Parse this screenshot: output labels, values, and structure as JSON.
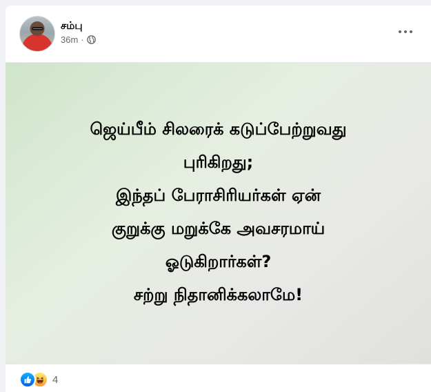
{
  "post": {
    "author": "சம்பு",
    "time": "36m",
    "separator": "·",
    "privacy_icon": "globe-icon",
    "image_text_lines": [
      "ஜெய்பீம் சிலரைக் கடுப்பேற்றுவது",
      "புரிகிறது;",
      "இந்தப் பேராசிரியர்கள் ஏன்",
      "குறுக்கு மறுக்கே அவசரமாய்",
      "ஓடுகிறார்கள்?",
      "சற்று நிதானிக்கலாமே!"
    ],
    "reaction_icons": [
      "like-icon",
      "haha-icon"
    ],
    "reaction_count": "4"
  },
  "colors": {
    "like_blue": "#1877f2",
    "haha_yellow": "#f7b125",
    "secondary_text": "#65676b"
  }
}
